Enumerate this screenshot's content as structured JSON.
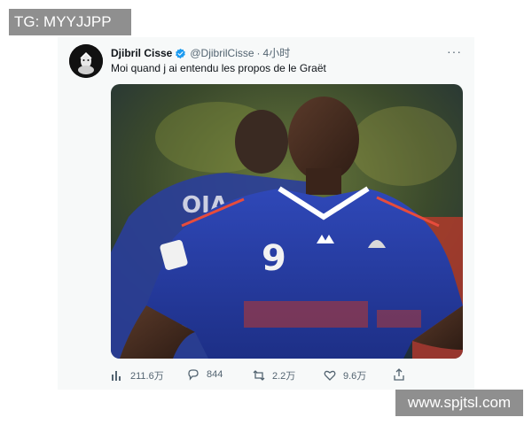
{
  "watermarks": {
    "top_left": "TG: MYYJJPP",
    "bottom_right": "www.spjtsl.com"
  },
  "tweet": {
    "author_name": "Djibril Cisse",
    "handle": "@DjibrilCisse",
    "separator": "·",
    "time": "4小时",
    "text": "Moi quand j ai entendu les propos de le Graët",
    "more": "···",
    "media": {
      "jersey_number": "9",
      "icon": "photo-footballer-in-blue-jersey"
    },
    "stats": {
      "views": "211.6万",
      "replies": "844",
      "retweets": "2.2万",
      "likes": "9.6万"
    }
  },
  "colors": {
    "verified": "#1d9bf0",
    "card_bg": "#f7f9f9",
    "muted": "#536471",
    "jersey": "#233a9c"
  }
}
